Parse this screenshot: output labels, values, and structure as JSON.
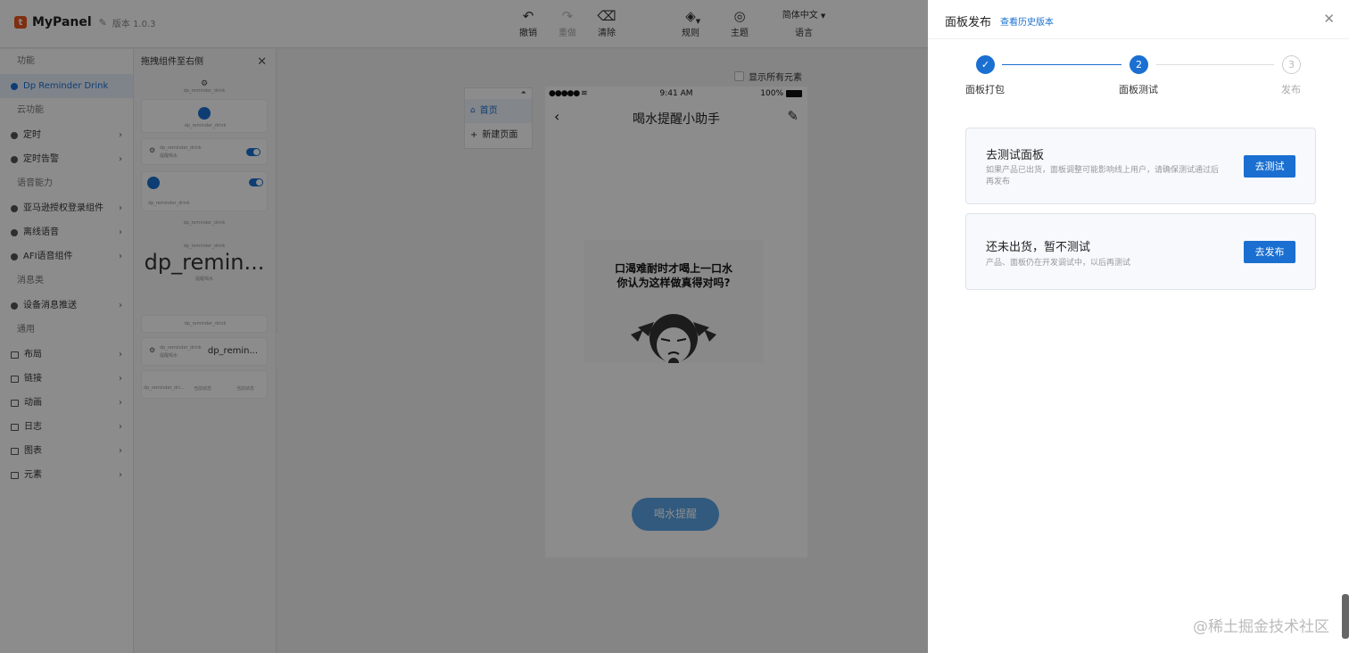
{
  "app": {
    "logo_letter": "t",
    "name": "MyPanel",
    "version": "版本 1.0.3"
  },
  "toolbar": {
    "undo": "撤销",
    "redo": "重做",
    "clear": "清除",
    "rules": "规则",
    "theme": "主题",
    "language_value": "简体中文",
    "language_label": "语言"
  },
  "sidebar": {
    "sections": {
      "function": "功能",
      "cloud": "云功能",
      "voice": "语音能力",
      "message": "消息类",
      "general": "通用"
    },
    "items": {
      "reminder": "Dp Reminder Drink",
      "timer": "定时",
      "timer_alarm": "定时告警",
      "amazon": "亚马逊授权登录组件",
      "offline_voice": "离线语音",
      "afi_voice": "AFI语音组件",
      "push": "设备消息推送",
      "layout": "布局",
      "link": "链接",
      "animation": "动画",
      "log": "日志",
      "chart": "图表",
      "element": "元素"
    }
  },
  "component_panel": {
    "title": "拖拽组件至右侧",
    "small_label": "dp_reminder_drink",
    "sub_label": "提醒喝水",
    "big_text": "dp_remin...",
    "card_text": "dp_remin...",
    "status_label": "当前状态",
    "row_label": "dp_reminder_dri..."
  },
  "canvas": {
    "show_all": "显示所有元素",
    "pages": [
      "首页",
      "新建页面"
    ],
    "status_time": "9:41 AM",
    "status_battery": "100%",
    "phone_title": "喝水提醒小助手",
    "meme_line1": "口渴难耐时才喝上一口水",
    "meme_line2": "你认为这样做真得对吗?",
    "drink_button": "喝水提醒"
  },
  "drawer": {
    "title": "面板发布",
    "history_link": "查看历史版本",
    "steps": [
      {
        "label": "面板打包",
        "state": "done",
        "number": "1"
      },
      {
        "label": "面板测试",
        "state": "current",
        "number": "2"
      },
      {
        "label": "发布",
        "state": "todo",
        "number": "3"
      }
    ],
    "options": [
      {
        "title": "去测试面板",
        "desc": "如果产品已出货，面板调整可能影响线上用户，请确保测试通过后再发布",
        "button": "去测试"
      },
      {
        "title": "还未出货，暂不测试",
        "desc": "产品、面板仍在开发调试中，以后再测试",
        "button": "去发布"
      }
    ]
  },
  "watermark": "@稀土掘金技术社区",
  "colors": {
    "primary": "#1a6fd1",
    "brand": "#e8541c",
    "mask": "rgba(0,0,0,0.45)"
  }
}
